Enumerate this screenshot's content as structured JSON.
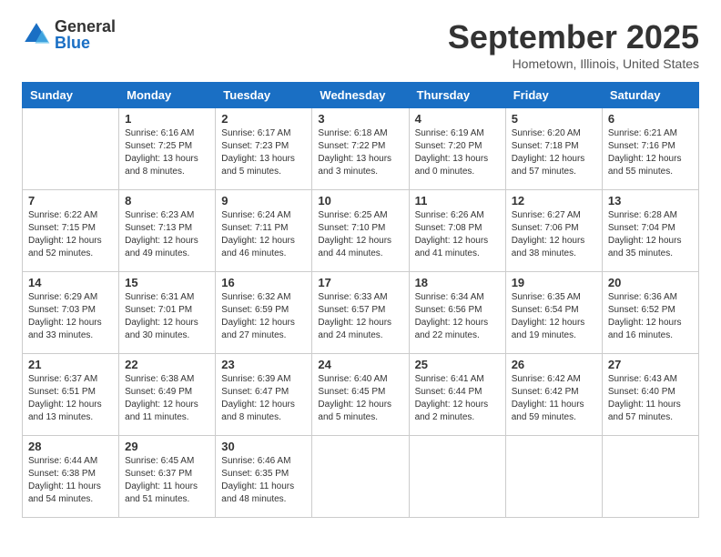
{
  "logo": {
    "general": "General",
    "blue": "Blue"
  },
  "title": "September 2025",
  "subtitle": "Hometown, Illinois, United States",
  "headers": [
    "Sunday",
    "Monday",
    "Tuesday",
    "Wednesday",
    "Thursday",
    "Friday",
    "Saturday"
  ],
  "weeks": [
    [
      {
        "day": "",
        "info": ""
      },
      {
        "day": "1",
        "info": "Sunrise: 6:16 AM\nSunset: 7:25 PM\nDaylight: 13 hours\nand 8 minutes."
      },
      {
        "day": "2",
        "info": "Sunrise: 6:17 AM\nSunset: 7:23 PM\nDaylight: 13 hours\nand 5 minutes."
      },
      {
        "day": "3",
        "info": "Sunrise: 6:18 AM\nSunset: 7:22 PM\nDaylight: 13 hours\nand 3 minutes."
      },
      {
        "day": "4",
        "info": "Sunrise: 6:19 AM\nSunset: 7:20 PM\nDaylight: 13 hours\nand 0 minutes."
      },
      {
        "day": "5",
        "info": "Sunrise: 6:20 AM\nSunset: 7:18 PM\nDaylight: 12 hours\nand 57 minutes."
      },
      {
        "day": "6",
        "info": "Sunrise: 6:21 AM\nSunset: 7:16 PM\nDaylight: 12 hours\nand 55 minutes."
      }
    ],
    [
      {
        "day": "7",
        "info": "Sunrise: 6:22 AM\nSunset: 7:15 PM\nDaylight: 12 hours\nand 52 minutes."
      },
      {
        "day": "8",
        "info": "Sunrise: 6:23 AM\nSunset: 7:13 PM\nDaylight: 12 hours\nand 49 minutes."
      },
      {
        "day": "9",
        "info": "Sunrise: 6:24 AM\nSunset: 7:11 PM\nDaylight: 12 hours\nand 46 minutes."
      },
      {
        "day": "10",
        "info": "Sunrise: 6:25 AM\nSunset: 7:10 PM\nDaylight: 12 hours\nand 44 minutes."
      },
      {
        "day": "11",
        "info": "Sunrise: 6:26 AM\nSunset: 7:08 PM\nDaylight: 12 hours\nand 41 minutes."
      },
      {
        "day": "12",
        "info": "Sunrise: 6:27 AM\nSunset: 7:06 PM\nDaylight: 12 hours\nand 38 minutes."
      },
      {
        "day": "13",
        "info": "Sunrise: 6:28 AM\nSunset: 7:04 PM\nDaylight: 12 hours\nand 35 minutes."
      }
    ],
    [
      {
        "day": "14",
        "info": "Sunrise: 6:29 AM\nSunset: 7:03 PM\nDaylight: 12 hours\nand 33 minutes."
      },
      {
        "day": "15",
        "info": "Sunrise: 6:31 AM\nSunset: 7:01 PM\nDaylight: 12 hours\nand 30 minutes."
      },
      {
        "day": "16",
        "info": "Sunrise: 6:32 AM\nSunset: 6:59 PM\nDaylight: 12 hours\nand 27 minutes."
      },
      {
        "day": "17",
        "info": "Sunrise: 6:33 AM\nSunset: 6:57 PM\nDaylight: 12 hours\nand 24 minutes."
      },
      {
        "day": "18",
        "info": "Sunrise: 6:34 AM\nSunset: 6:56 PM\nDaylight: 12 hours\nand 22 minutes."
      },
      {
        "day": "19",
        "info": "Sunrise: 6:35 AM\nSunset: 6:54 PM\nDaylight: 12 hours\nand 19 minutes."
      },
      {
        "day": "20",
        "info": "Sunrise: 6:36 AM\nSunset: 6:52 PM\nDaylight: 12 hours\nand 16 minutes."
      }
    ],
    [
      {
        "day": "21",
        "info": "Sunrise: 6:37 AM\nSunset: 6:51 PM\nDaylight: 12 hours\nand 13 minutes."
      },
      {
        "day": "22",
        "info": "Sunrise: 6:38 AM\nSunset: 6:49 PM\nDaylight: 12 hours\nand 11 minutes."
      },
      {
        "day": "23",
        "info": "Sunrise: 6:39 AM\nSunset: 6:47 PM\nDaylight: 12 hours\nand 8 minutes."
      },
      {
        "day": "24",
        "info": "Sunrise: 6:40 AM\nSunset: 6:45 PM\nDaylight: 12 hours\nand 5 minutes."
      },
      {
        "day": "25",
        "info": "Sunrise: 6:41 AM\nSunset: 6:44 PM\nDaylight: 12 hours\nand 2 minutes."
      },
      {
        "day": "26",
        "info": "Sunrise: 6:42 AM\nSunset: 6:42 PM\nDaylight: 11 hours\nand 59 minutes."
      },
      {
        "day": "27",
        "info": "Sunrise: 6:43 AM\nSunset: 6:40 PM\nDaylight: 11 hours\nand 57 minutes."
      }
    ],
    [
      {
        "day": "28",
        "info": "Sunrise: 6:44 AM\nSunset: 6:38 PM\nDaylight: 11 hours\nand 54 minutes."
      },
      {
        "day": "29",
        "info": "Sunrise: 6:45 AM\nSunset: 6:37 PM\nDaylight: 11 hours\nand 51 minutes."
      },
      {
        "day": "30",
        "info": "Sunrise: 6:46 AM\nSunset: 6:35 PM\nDaylight: 11 hours\nand 48 minutes."
      },
      {
        "day": "",
        "info": ""
      },
      {
        "day": "",
        "info": ""
      },
      {
        "day": "",
        "info": ""
      },
      {
        "day": "",
        "info": ""
      }
    ]
  ]
}
